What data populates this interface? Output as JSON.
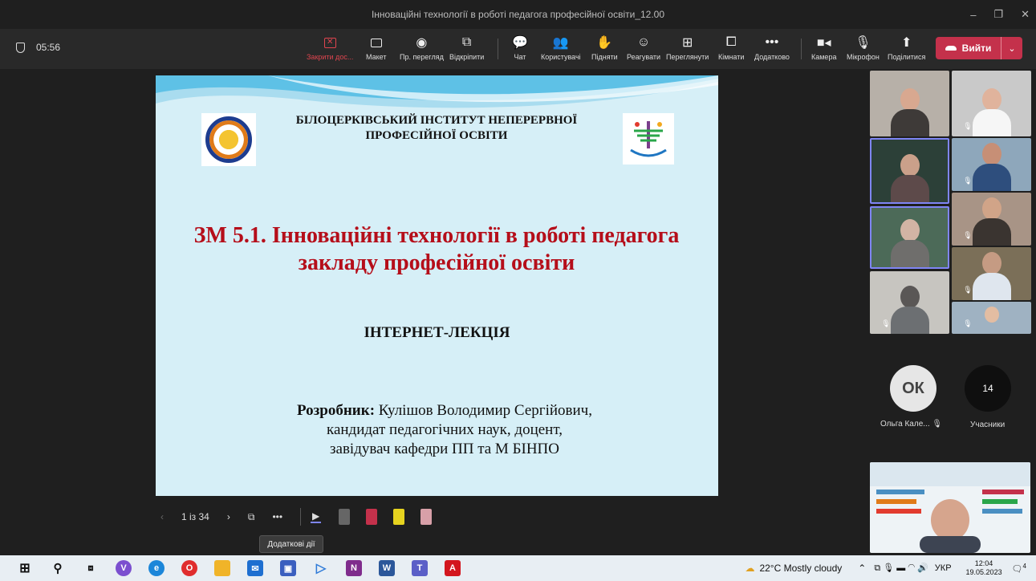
{
  "window": {
    "title": "Інноваційні технології в роботі педагога професійної освіти_12.00",
    "controls": [
      "–",
      "❐",
      "✕"
    ]
  },
  "toolbar": {
    "timer": "05:56",
    "buttons": [
      {
        "label": "Закрити дос...",
        "icon": "close-share-icon",
        "color": "#e0454f"
      },
      {
        "label": "Макет",
        "icon": "layout-icon"
      },
      {
        "label": "Пр. перегляд",
        "icon": "preview-icon"
      },
      {
        "label": "Відкріпити",
        "icon": "popout-icon"
      },
      {
        "label": "Чат",
        "icon": "chat-icon"
      },
      {
        "label": "Користувачі",
        "icon": "people-icon"
      },
      {
        "label": "Підняти",
        "icon": "raise-hand-icon"
      },
      {
        "label": "Реагувати",
        "icon": "react-icon"
      },
      {
        "label": "Переглянути",
        "icon": "view-icon"
      },
      {
        "label": "Кімнати",
        "icon": "rooms-icon"
      },
      {
        "label": "Додатково",
        "icon": "more-icon"
      },
      {
        "label": "Камера",
        "icon": "camera-icon"
      },
      {
        "label": "Мікрофон",
        "icon": "mic-icon"
      },
      {
        "label": "Поділитися",
        "icon": "share-icon"
      }
    ],
    "leave_label": "Вийти",
    "leave_color": "#c4314b"
  },
  "slide": {
    "institute": "БІЛОЦЕРКІВСЬКИЙ ІНСТИТУТ НЕПЕРЕРВНОЇ ПРОФЕСІЙНОЇ ОСВІТИ",
    "title": "ЗМ 5.1. Інноваційні технології в роботі педагога закладу професійної освіти",
    "subtitle": "ІНТЕРНЕТ-ЛЕКЦІЯ",
    "author_label": "Розробник:",
    "author_name": "Кулішов Володимир Сергійович,",
    "author_line2": "кандидат педагогічних наук, доцент,",
    "author_line3": "завідувач кафедри ПП та М БІНПО",
    "title_color": "#b50e1a"
  },
  "slide_controls": {
    "page": "1 із 34",
    "tooltip": "Додаткові дії"
  },
  "participants": {
    "avatar_initials": "ОК",
    "avatar_name": "Ольга Кале...",
    "count": "14",
    "count_label": "Учасники"
  },
  "taskbar": {
    "weather": "22°C  Mostly cloudy",
    "language": "УКР",
    "time": "12:04",
    "date": "19.05.2023",
    "notifications": "4"
  }
}
